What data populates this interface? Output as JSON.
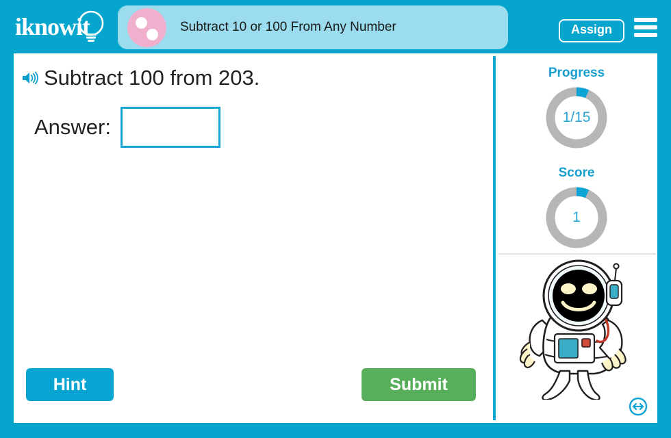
{
  "brand": {
    "logo_text": "iknowit",
    "logo_icon": "lightbulb-icon",
    "primary_color": "#06a5ce",
    "pill_color": "#9bdcee",
    "avatar_color": "#efafcd",
    "accent_blue": "#17a5d4",
    "submit_green": "#57ae5b",
    "ring_grey": "#b6b6b6"
  },
  "header": {
    "lesson_title": "Subtract 10 or 100 From Any Number",
    "assign_label": "Assign",
    "menu_icon": "hamburger-menu-icon",
    "avatar_icon": "pink-dots-avatar-icon"
  },
  "question": {
    "speaker_icon": "speaker-audio-icon",
    "prompt": "Subtract 100 from 203.",
    "answer_label": "Answer:",
    "answer_value": "",
    "answer_placeholder": ""
  },
  "actions": {
    "hint_label": "Hint",
    "submit_label": "Submit"
  },
  "sidebar": {
    "progress": {
      "title": "Progress",
      "value_text": "1/15",
      "current": 1,
      "total": 15,
      "percent": 6.7
    },
    "score": {
      "title": "Score",
      "value_text": "1",
      "value": 1,
      "percent": 6.7
    },
    "mascot_icon": "astronaut-mascot-icon",
    "resize_icon": "resize-horizontal-icon"
  }
}
